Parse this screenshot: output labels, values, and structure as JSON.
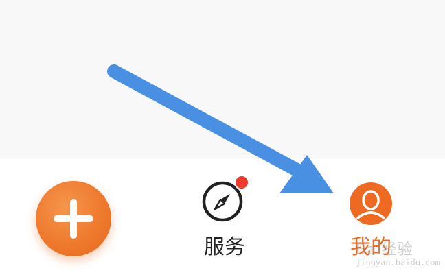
{
  "tab_bar": {
    "add_button_icon": "plus-icon",
    "service": {
      "label": "服务",
      "icon": "compass-icon",
      "has_notification_dot": true
    },
    "mine": {
      "label": "我的",
      "icon": "avatar-icon",
      "active": true
    }
  },
  "watermark": {
    "main": "Bai经验",
    "sub": "jingyan.baidu.com"
  },
  "colors": {
    "accent_orange": "#ee7a2e",
    "active_label": "#ee6a22",
    "notification_red": "#ee3b2d",
    "arrow_blue": "#4a90e2",
    "content_bg": "#f8f8f8"
  }
}
